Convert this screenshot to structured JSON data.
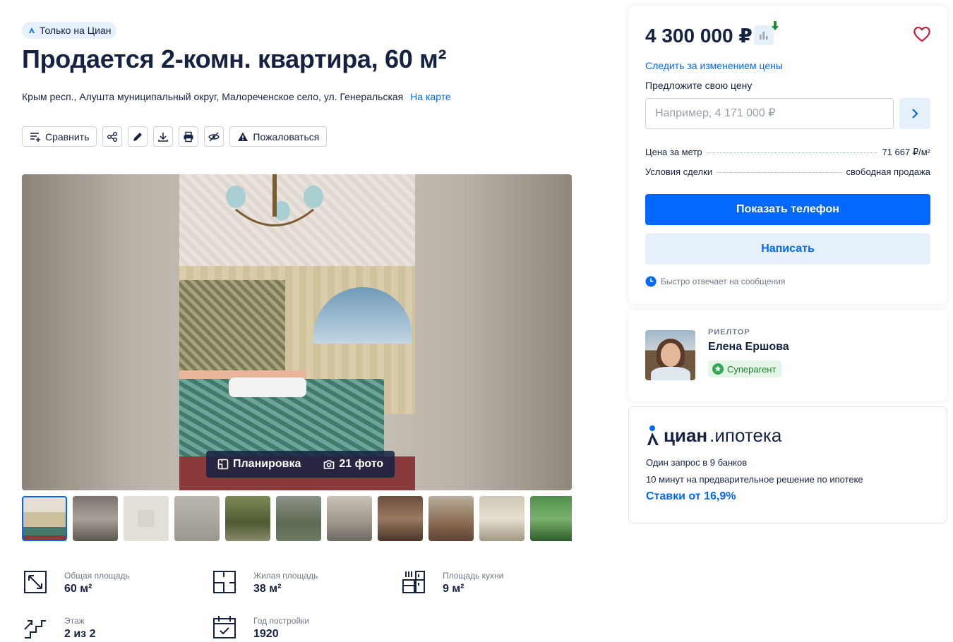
{
  "badge": {
    "label": "Только на Циан"
  },
  "title": "Продается 2-комн. квартира, 60 м²",
  "address": {
    "text": "Крым респ., Алушта муниципальный округ, Малореченское село, ул. Генеральская",
    "map_link": "На карте"
  },
  "toolbar": {
    "compare_label": "Сравнить",
    "complain_label": "Пожаловаться",
    "icons": [
      "share-icon",
      "edit-icon",
      "download-icon",
      "print-icon",
      "hide-icon"
    ]
  },
  "gallery": {
    "plan_label": "Планировка",
    "photos_label": "21 фото",
    "thumb_count": 11
  },
  "params": [
    {
      "label": "Общая площадь",
      "value": "60 м²",
      "icon": "area-icon"
    },
    {
      "label": "Жилая площадь",
      "value": "38 м²",
      "icon": "living-area-icon"
    },
    {
      "label": "Площадь кухни",
      "value": "9 м²",
      "icon": "kitchen-icon"
    },
    {
      "label": "Этаж",
      "value": "2 из 2",
      "icon": "stairs-icon"
    },
    {
      "label": "Год постройки",
      "value": "1920",
      "icon": "calendar-icon"
    }
  ],
  "price_card": {
    "price": "4 300 000 ₽",
    "follow_label": "Следить за изменением цены",
    "offer_label": "Предложите свою цену",
    "offer_placeholder": "Например, 4 171 000 ₽",
    "rows": [
      {
        "label": "Цена за метр",
        "value": "71 667 ₽/м²"
      },
      {
        "label": "Условия сделки",
        "value": "свободная продажа"
      }
    ],
    "phone_button": "Показать телефон",
    "write_button": "Написать",
    "fast_reply": "Быстро отвечает на сообщения"
  },
  "agent": {
    "role": "РИЕЛТОР",
    "name": "Елена Ершова",
    "badge": "Суперагент"
  },
  "mortgage": {
    "brand_bold": "циан",
    "brand_rest": ".ипотека",
    "line1": "Один запрос в 9 банков",
    "line2": "10 минут на предварительное решение по ипотеке",
    "rate": "Ставки от 16,9%"
  },
  "colors": {
    "accent": "#0468ff",
    "text": "#152242",
    "muted": "#707a89",
    "accent_light": "#e6f0fb",
    "success": "#1b7f2c"
  }
}
